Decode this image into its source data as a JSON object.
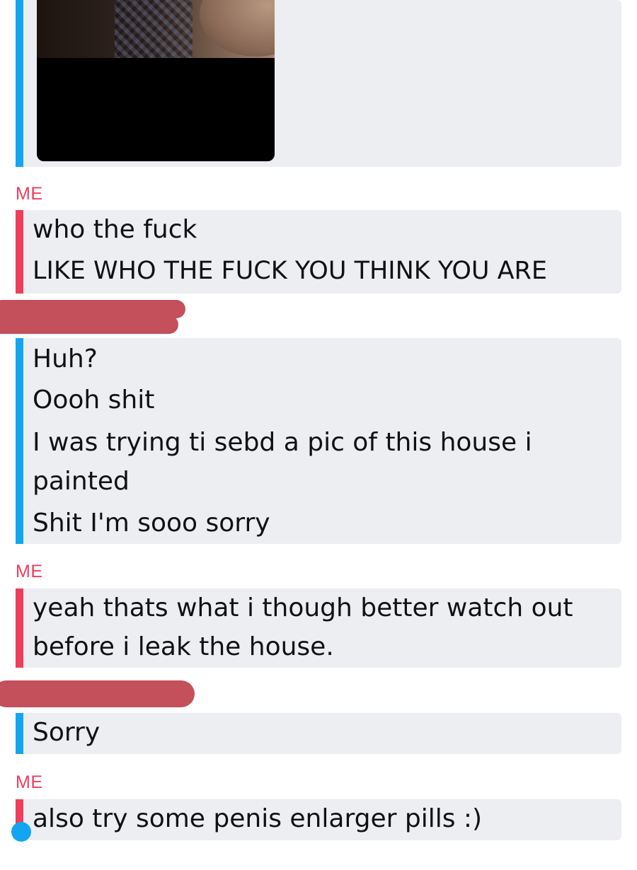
{
  "colors": {
    "me_accent": "#ef3d5b",
    "them_accent": "#12a6f2",
    "bubble_bg": "#eceef2",
    "redaction": "#c3505a"
  },
  "messages": [
    {
      "sender": "",
      "type": "image",
      "icon": "photo-attachment"
    },
    {
      "sender": "ME",
      "lines": [
        "who the fuck",
        "LIKE WHO THE FUCK YOU THINK YOU ARE"
      ]
    },
    {
      "sender": "",
      "lines": [
        "Huh?",
        "Oooh shit",
        "I was trying ti sebd a pic of this house i",
        "painted",
        "Shit I'm sooo sorry"
      ]
    },
    {
      "sender": "ME",
      "lines": [
        "yeah thats what i though better watch out",
        "before i leak the house."
      ]
    },
    {
      "sender": "",
      "lines": [
        "Sorry"
      ]
    },
    {
      "sender": "ME",
      "lines": [
        "also try some penis enlarger pills :)"
      ]
    }
  ]
}
